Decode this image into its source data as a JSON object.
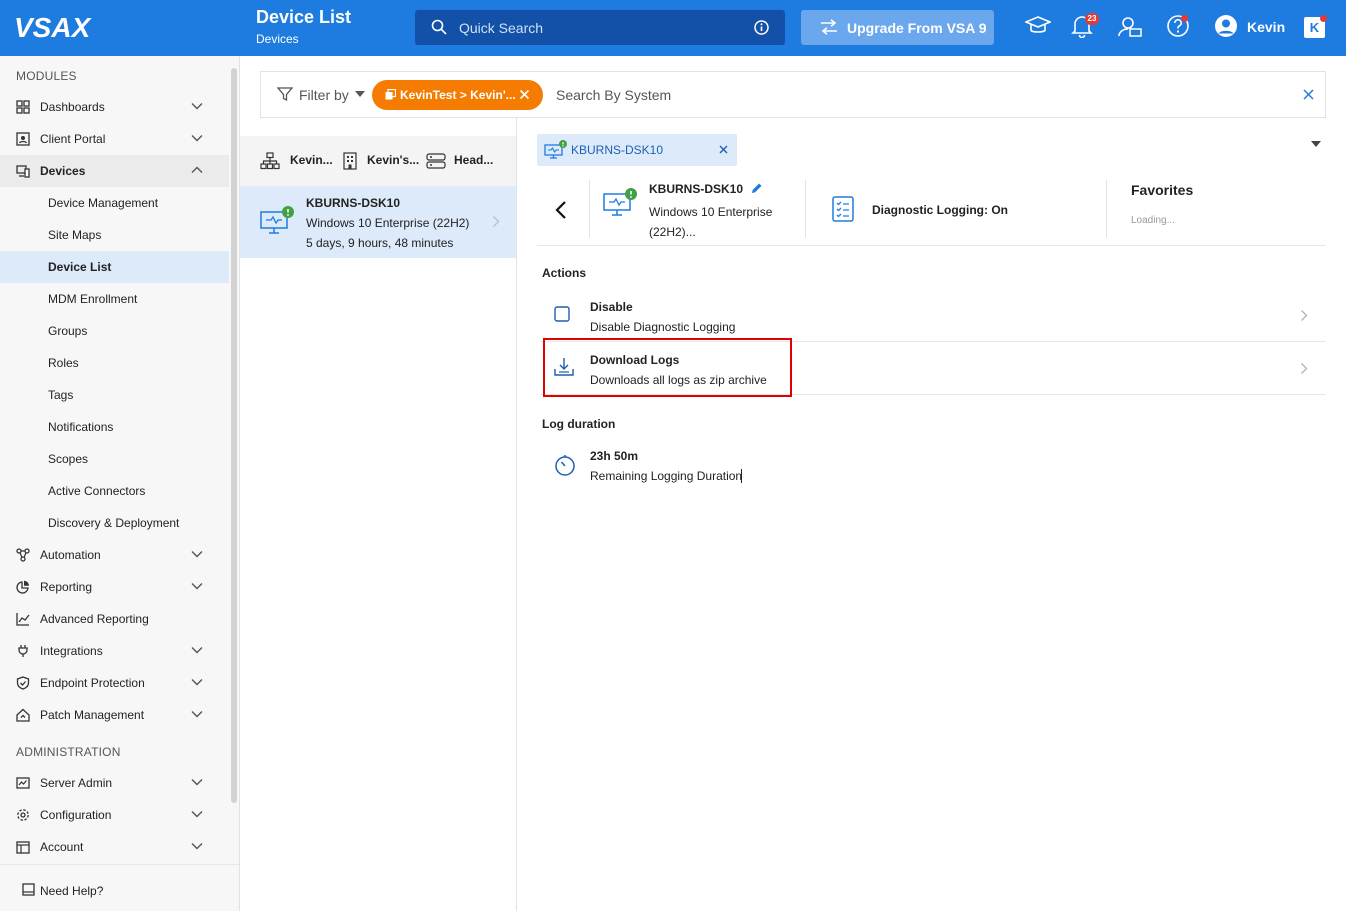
{
  "app": {
    "logo": "VSAX"
  },
  "header": {
    "title": "Device List",
    "subtitle": "Devices",
    "search_placeholder": "Quick Search",
    "upgrade_label": "Upgrade From VSA 9",
    "notification_count": "23",
    "user_name": "Kevin",
    "brand_badge": "K"
  },
  "sidebar": {
    "modules_title": "MODULES",
    "admin_title": "ADMINISTRATION",
    "items": [
      {
        "label": "Dashboards",
        "icon": "dashboard-icon"
      },
      {
        "label": "Client Portal",
        "icon": "portal-icon"
      },
      {
        "label": "Devices",
        "icon": "devices-icon"
      },
      {
        "label": "Automation",
        "icon": "automation-icon"
      },
      {
        "label": "Reporting",
        "icon": "reporting-icon"
      },
      {
        "label": "Advanced Reporting",
        "icon": "chart-icon"
      },
      {
        "label": "Integrations",
        "icon": "plug-icon"
      },
      {
        "label": "Endpoint Protection",
        "icon": "shield-icon"
      },
      {
        "label": "Patch Management",
        "icon": "patch-icon"
      }
    ],
    "device_sub": [
      "Device Management",
      "Site Maps",
      "Device List",
      "MDM Enrollment",
      "Groups",
      "Roles",
      "Tags",
      "Notifications",
      "Scopes",
      "Active Connectors",
      "Discovery & Deployment"
    ],
    "admin_items": [
      {
        "label": "Server Admin",
        "icon": "server-icon"
      },
      {
        "label": "Configuration",
        "icon": "gear-icon"
      },
      {
        "label": "Account",
        "icon": "account-icon"
      }
    ],
    "help_label": "Need Help?"
  },
  "filter": {
    "label": "Filter by",
    "chip_label": "KevinTest > Kevin'...",
    "search_placeholder": "Search By System"
  },
  "device_list": {
    "crumbs": [
      "Kevin...",
      "Kevin's...",
      "Head..."
    ],
    "device": {
      "name": "KBURNS-DSK10",
      "os": "Windows 10 Enterprise (22H2)",
      "uptime": "5 days, 9 hours, 48 minutes"
    }
  },
  "detail": {
    "tab_label": "KBURNS-DSK10",
    "device_name": "KBURNS-DSK10",
    "device_os": "Windows 10 Enterprise (22H2)...",
    "diag_status": "Diagnostic Logging: On",
    "favorites_title": "Favorites",
    "favorites_status": "Loading...",
    "actions_title": "Actions",
    "actions": [
      {
        "title": "Disable",
        "desc": "Disable Diagnostic Logging"
      },
      {
        "title": "Download Logs",
        "desc": "Downloads all logs as zip archive"
      }
    ],
    "duration_title": "Log duration",
    "duration_value": "23h 50m",
    "duration_desc": "Remaining Logging Duration"
  },
  "colors": {
    "primary": "#1e7be0",
    "search_bg": "#1351a8",
    "upgrade_bg": "#6aa7ec",
    "chip": "#f57c00",
    "selected_bg": "#ddeafa",
    "highlight": "#e00000",
    "status_ok": "#43a047"
  }
}
